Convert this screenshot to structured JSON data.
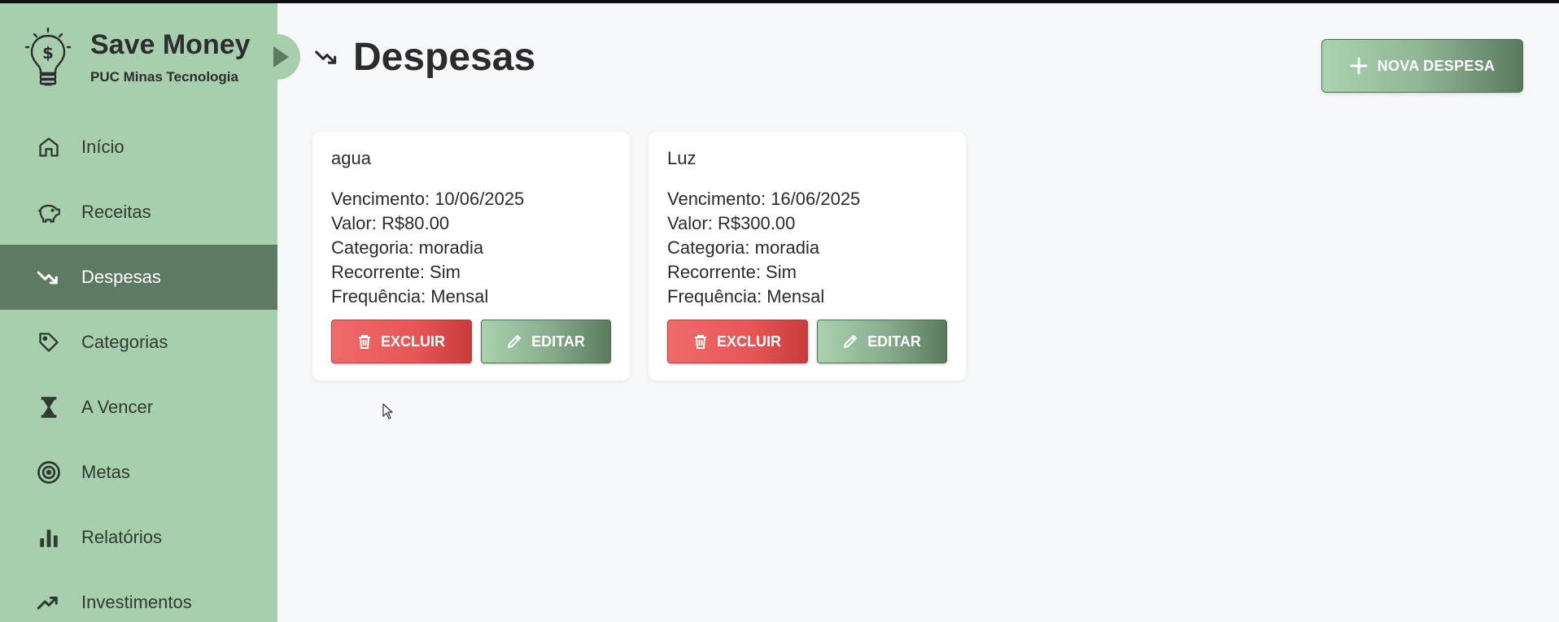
{
  "brand": {
    "title": "Save Money",
    "subtitle": "PUC Minas Tecnologia"
  },
  "sidebar": {
    "items": [
      {
        "label": "Início",
        "icon": "home-icon",
        "active": false
      },
      {
        "label": "Receitas",
        "icon": "piggy-bank-icon",
        "active": false
      },
      {
        "label": "Despesas",
        "icon": "trending-down-icon",
        "active": true
      },
      {
        "label": "Categorias",
        "icon": "tag-icon",
        "active": false
      },
      {
        "label": "A Vencer",
        "icon": "hourglass-icon",
        "active": false
      },
      {
        "label": "Metas",
        "icon": "target-icon",
        "active": false
      },
      {
        "label": "Relatórios",
        "icon": "bar-chart-icon",
        "active": false
      },
      {
        "label": "Investimentos",
        "icon": "trending-up-icon",
        "active": false
      }
    ]
  },
  "header": {
    "title": "Despesas",
    "new_button_label": "NOVA DESPESA"
  },
  "expenses": [
    {
      "name": "agua",
      "vencimento": "Vencimento: 10/06/2025",
      "valor": "Valor: R$80.00",
      "categoria": "Categoria: moradia",
      "recorrente": "Recorrente: Sim",
      "frequencia": "Frequência: Mensal",
      "delete_label": "EXCLUIR",
      "edit_label": "EDITAR"
    },
    {
      "name": "Luz",
      "vencimento": "Vencimento: 16/06/2025",
      "valor": "Valor: R$300.00",
      "categoria": "Categoria: moradia",
      "recorrente": "Recorrente: Sim",
      "frequencia": "Frequência: Mensal",
      "delete_label": "EXCLUIR",
      "edit_label": "EDITAR"
    }
  ],
  "colors": {
    "sidebar_bg": "#a7cfad",
    "sidebar_active": "#5f7a63",
    "danger": "#e85555",
    "accent": "#5a7a5e"
  }
}
